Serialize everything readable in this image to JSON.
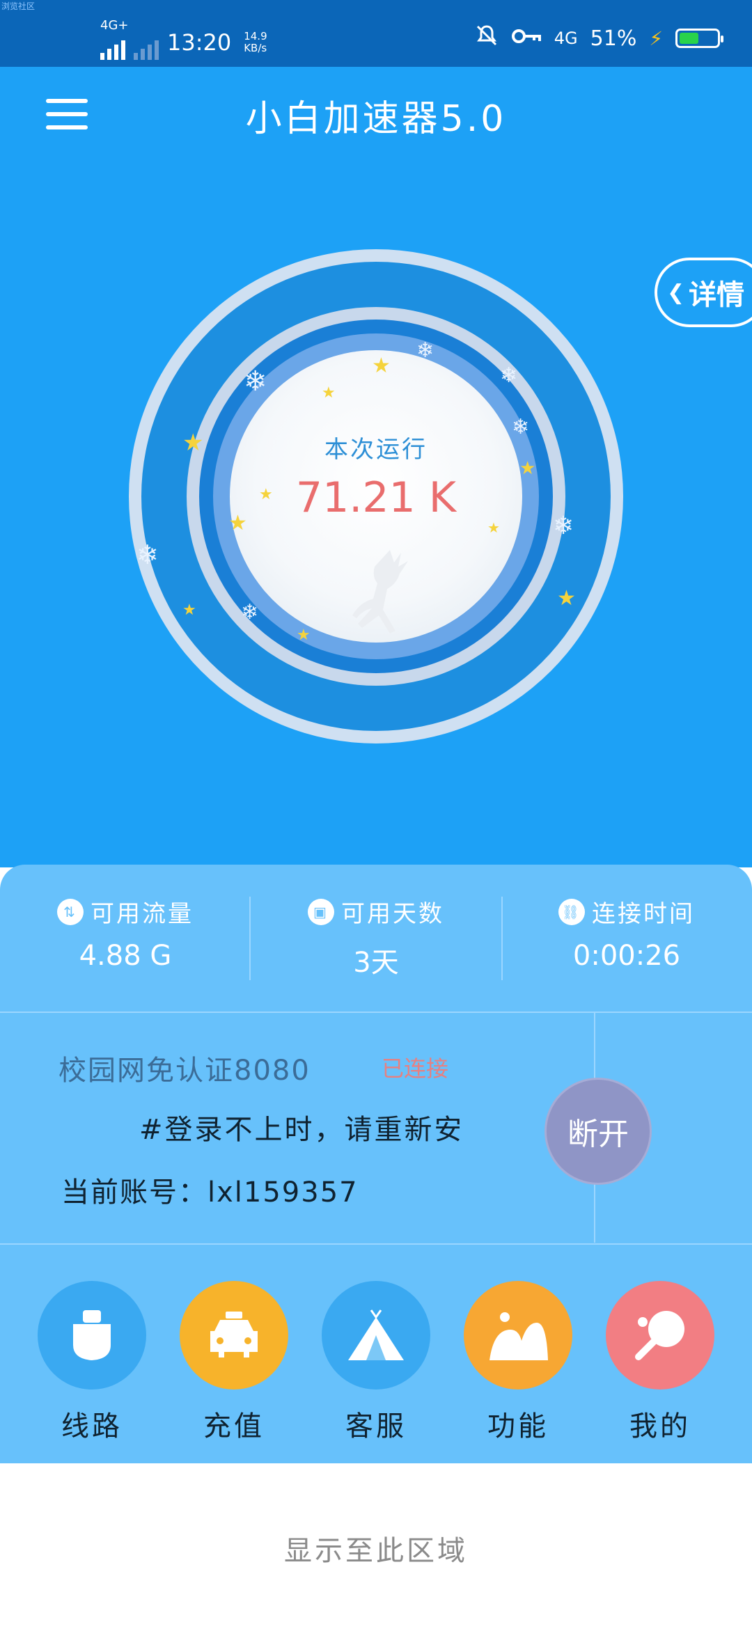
{
  "status_bar": {
    "tag": "浏览社区",
    "network": "4G+",
    "time": "13:20",
    "speed_value": "14.9",
    "speed_unit": "KB/s",
    "network_right": "4G",
    "battery": "51%",
    "battery_level": 0.51,
    "icons": [
      "signal-icon",
      "mute-icon",
      "key-icon",
      "battery-icon",
      "charging-icon"
    ]
  },
  "header": {
    "title": "小白加速器5.0"
  },
  "detail_button": {
    "arrow": "❮",
    "label": "详情"
  },
  "gauge": {
    "label": "本次运行",
    "value": "71.21 K"
  },
  "stats": [
    {
      "icon": "⇅",
      "label": "可用流量",
      "value": "4.88 G"
    },
    {
      "icon": "▣",
      "label": "可用天数",
      "value": "3天"
    },
    {
      "icon": "⛓",
      "label": "连接时间",
      "value": "0:00:26"
    }
  ],
  "connection": {
    "server_name": "校园网免认证8080",
    "status": "已连接",
    "notice": "#登录不上时，请重新安",
    "account_label": "当前账号：",
    "account_value": "lxl159357",
    "disconnect_label": "断开"
  },
  "nav": [
    {
      "label": "线路",
      "icon": "ship-icon",
      "color": "#3aa9f1"
    },
    {
      "label": "充值",
      "icon": "taxi-icon",
      "color": "#f7b32b"
    },
    {
      "label": "客服",
      "icon": "tent-icon",
      "color": "#3aa9f1"
    },
    {
      "label": "功能",
      "icon": "mountain-icon",
      "color": "#f7a733"
    },
    {
      "label": "我的",
      "icon": "ping-pong-icon",
      "color": "#f27e83"
    }
  ],
  "footer": {
    "text": "显示至此区域"
  },
  "colors": {
    "primary": "#1da1f6",
    "panel": "#67c1fb",
    "status_bar": "#0b66b8",
    "accent_red": "#e96d6d",
    "disconnect": "#8f95c6"
  }
}
